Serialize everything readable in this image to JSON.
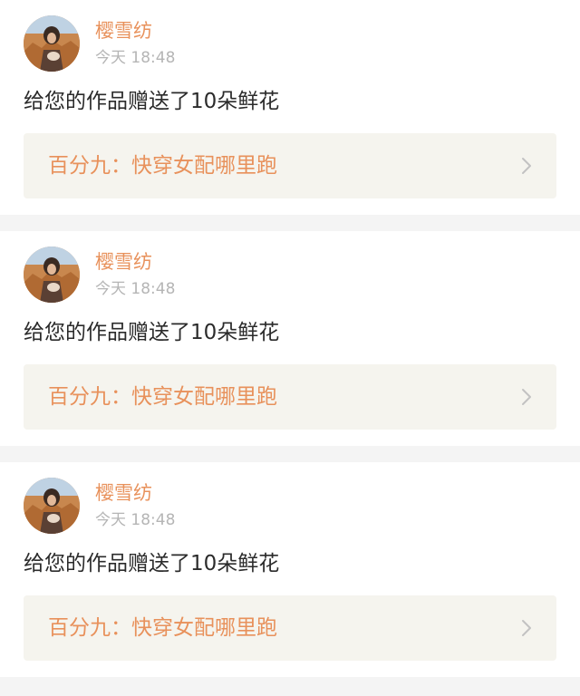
{
  "notifications": [
    {
      "username": "樱雪纺",
      "time": "今天 18:48",
      "message": "给您的作品赠送了10朵鲜花",
      "work_title": "百分九：快穿女配哪里跑",
      "avatar_icon": "user-avatar-photo",
      "chevron_icon": "chevron-right-icon"
    },
    {
      "username": "樱雪纺",
      "time": "今天 18:48",
      "message": "给您的作品赠送了10朵鲜花",
      "work_title": "百分九：快穿女配哪里跑",
      "avatar_icon": "user-avatar-photo",
      "chevron_icon": "chevron-right-icon"
    },
    {
      "username": "樱雪纺",
      "time": "今天 18:48",
      "message": "给您的作品赠送了10朵鲜花",
      "work_title": "百分九：快穿女配哪里跑",
      "avatar_icon": "user-avatar-photo",
      "chevron_icon": "chevron-right-icon"
    }
  ],
  "colors": {
    "accent": "#e8915b",
    "page_background": "#f4f4f4",
    "card_background": "#ffffff",
    "link_background": "#f5f4ee",
    "timestamp": "#b5b5b5",
    "body_text": "#2b2b2b"
  }
}
